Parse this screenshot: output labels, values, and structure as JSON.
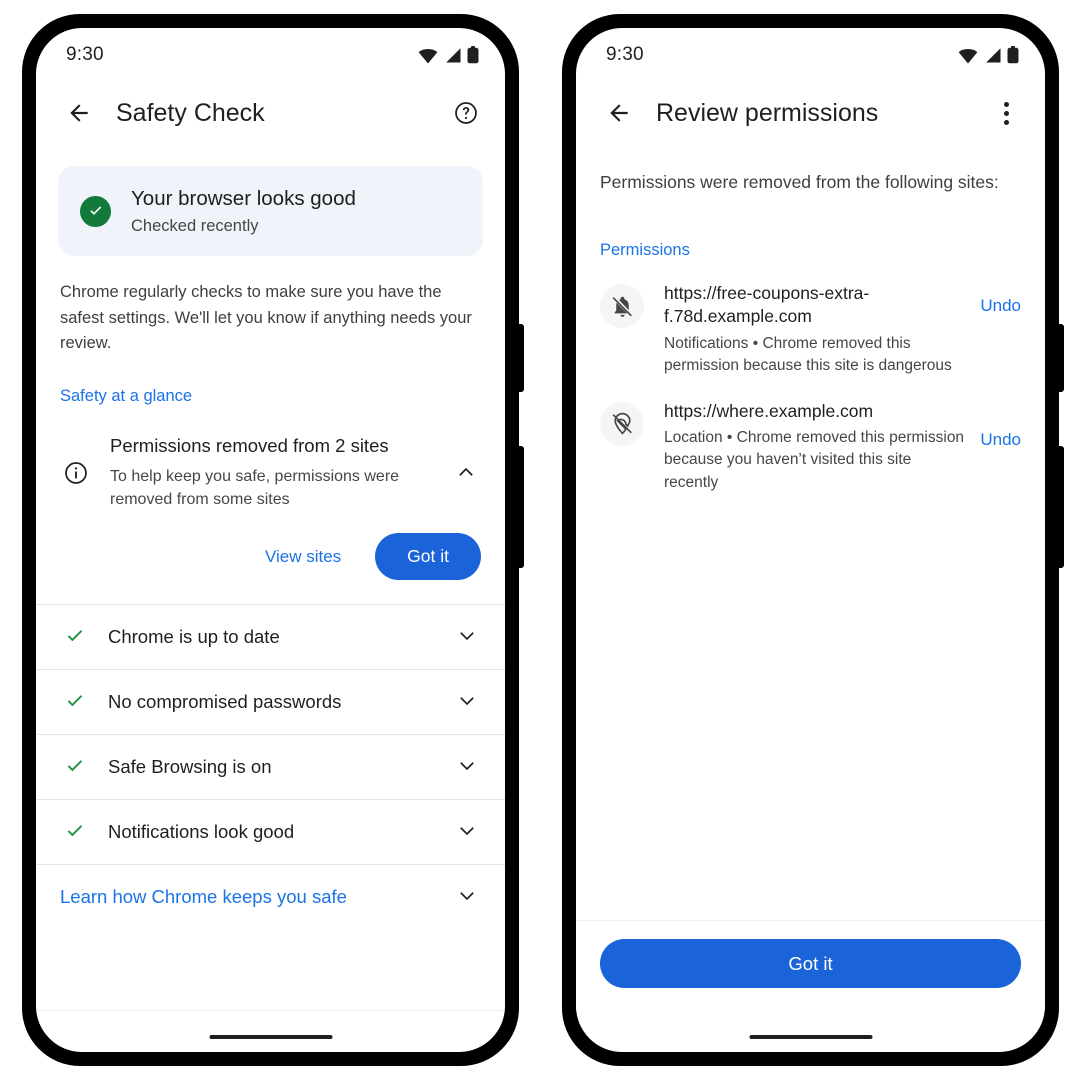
{
  "left_phone": {
    "status": {
      "time": "9:30",
      "icons": [
        "wifi-icon",
        "cellular-icon",
        "battery-icon"
      ]
    },
    "appbar": {
      "back": "back-arrow-icon",
      "title": "Safety Check",
      "action": "help-icon"
    },
    "banner": {
      "icon": "check-circle-icon",
      "title": "Your browser looks good",
      "subtitle": "Checked recently"
    },
    "paragraph": "Chrome regularly checks to make sure you have the safest settings. We'll let you know if anything needs your review.",
    "section_link": "Safety at a glance",
    "expanded_row": {
      "icon": "info-icon",
      "title": "Permissions removed from 2 sites",
      "subtitle": "To help keep you safe, permissions were removed from some sites",
      "chevron": "chevron-up-icon",
      "secondary_action": "View sites",
      "primary_action": "Got it"
    },
    "check_items": [
      {
        "label": "Chrome is up to date",
        "icon": "check-icon",
        "chevron": "chevron-down-icon"
      },
      {
        "label": "No compromised passwords",
        "icon": "check-icon",
        "chevron": "chevron-down-icon"
      },
      {
        "label": "Safe Browsing is on",
        "icon": "check-icon",
        "chevron": "chevron-down-icon"
      },
      {
        "label": "Notifications look good",
        "icon": "check-icon",
        "chevron": "chevron-down-icon"
      }
    ],
    "learn_more": {
      "label": "Learn how Chrome keeps you safe",
      "chevron": "chevron-down-icon"
    }
  },
  "right_phone": {
    "status": {
      "time": "9:30",
      "icons": [
        "wifi-icon",
        "cellular-icon",
        "battery-icon"
      ]
    },
    "appbar": {
      "back": "back-arrow-icon",
      "title": "Review permissions",
      "action": "overflow-menu-icon"
    },
    "intro": "Permissions were removed from the following sites:",
    "section_label": "Permissions",
    "permissions": [
      {
        "icon": "notifications-off-icon",
        "site": "https://free-coupons-extra-f.78d.example.com",
        "description": "Notifications • Chrome removed this permission because this site is dangerous",
        "undo": "Undo"
      },
      {
        "icon": "location-off-icon",
        "site": "https://where.example.com",
        "description": "Location • Chrome removed this permission because you haven’t visited this site recently",
        "undo": "Undo"
      }
    ],
    "cta": "Got it"
  },
  "colors": {
    "accent_blue": "#1a73e8",
    "button_blue": "#1a63d8",
    "success_green": "#127a3a",
    "banner_bg": "#f0f3fa",
    "text_primary": "#1f1f1f",
    "text_secondary": "#444746"
  }
}
